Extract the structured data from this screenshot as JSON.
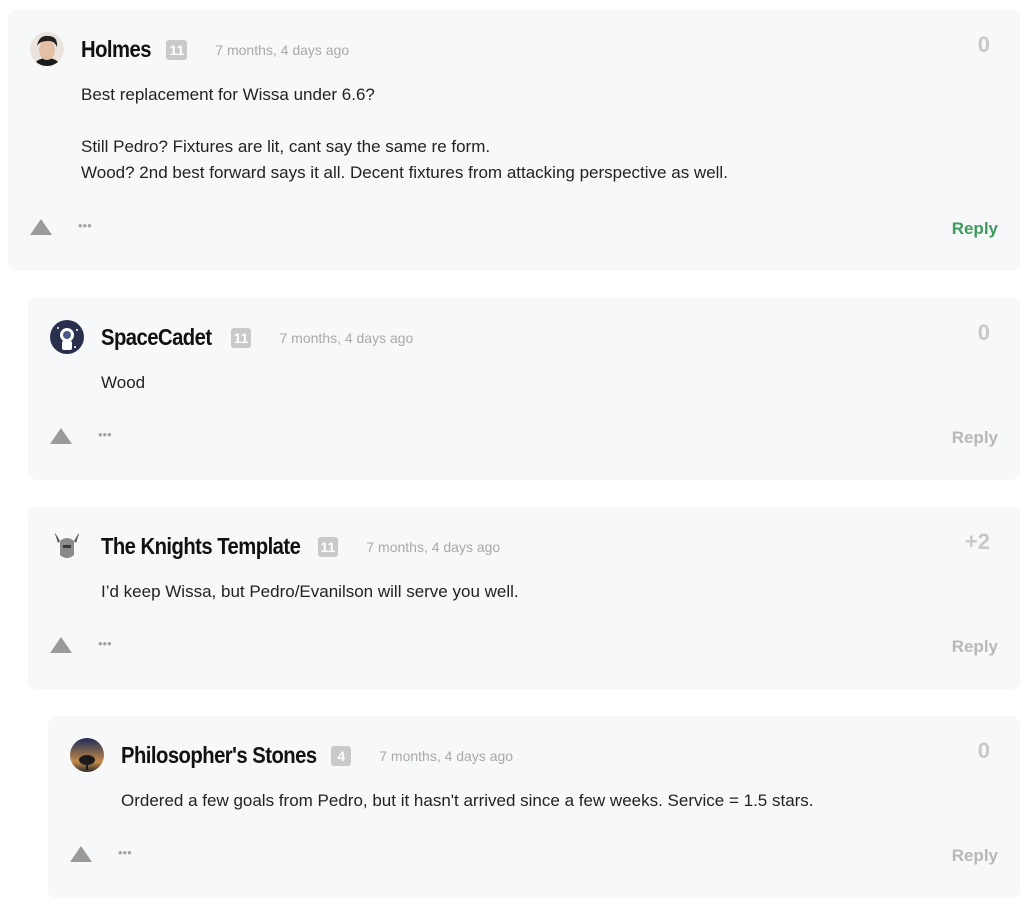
{
  "comments": [
    {
      "author": "Holmes",
      "level": "11",
      "time": "7 months, 4 days ago",
      "score": "0",
      "lines": [
        "Best replacement for Wissa under 6.6?",
        "",
        "Still Pedro? Fixtures are lit, cant say the same re form.",
        "Wood? 2nd best forward says it all. Decent fixtures from attacking perspective as well."
      ],
      "reply_label": "Reply",
      "more_label": "•••"
    },
    {
      "author": "SpaceCadet",
      "level": "11",
      "time": "7 months, 4 days ago",
      "score": "0",
      "lines": [
        "Wood"
      ],
      "reply_label": "Reply",
      "more_label": "•••"
    },
    {
      "author": "The Knights Template",
      "level": "11",
      "time": "7 months, 4 days ago",
      "score": "+2",
      "lines": [
        "I’d keep Wissa, but Pedro/Evanilson will serve you well."
      ],
      "reply_label": "Reply",
      "more_label": "•••"
    },
    {
      "author": "Philosopher's Stones",
      "level": "4",
      "time": "7 months, 4 days ago",
      "score": "0",
      "lines": [
        "Ordered a few goals from Pedro, but it hasn't arrived since a few weeks. Service = 1.5 stars."
      ],
      "reply_label": "Reply",
      "more_label": "•••"
    }
  ],
  "colors": {
    "card_bg": "#f7f8fa",
    "reply_active": "#3f9a5d",
    "reply_inactive": "#b8b8b8"
  }
}
